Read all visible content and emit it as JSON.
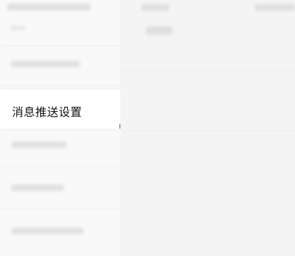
{
  "sidebar": {
    "selected_item": {
      "label": "消息推送设置"
    }
  }
}
